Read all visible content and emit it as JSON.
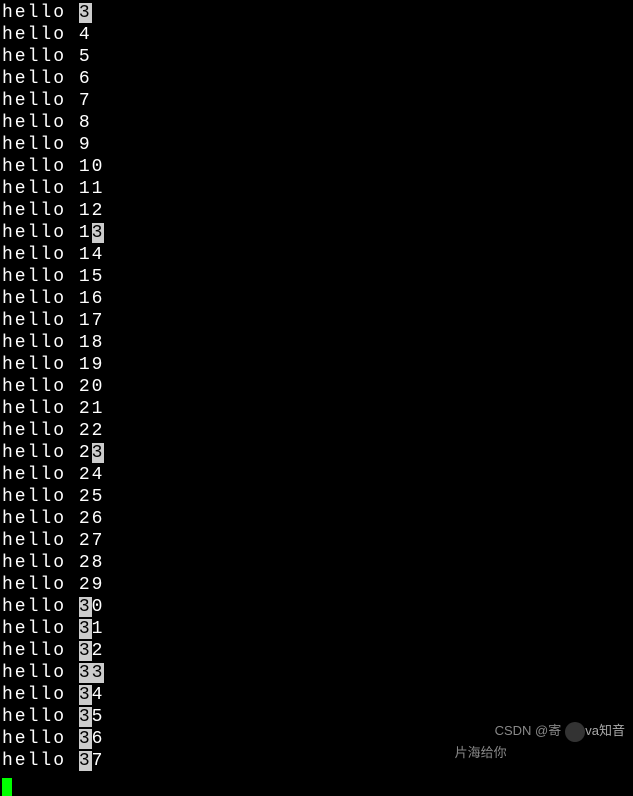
{
  "terminal": {
    "prefix": "hello ",
    "lines": [
      {
        "num": "3",
        "highlight_start": 0,
        "highlight_end": 1
      },
      {
        "num": "4",
        "highlight_start": -1,
        "highlight_end": -1
      },
      {
        "num": "5",
        "highlight_start": -1,
        "highlight_end": -1
      },
      {
        "num": "6",
        "highlight_start": -1,
        "highlight_end": -1
      },
      {
        "num": "7",
        "highlight_start": -1,
        "highlight_end": -1
      },
      {
        "num": "8",
        "highlight_start": -1,
        "highlight_end": -1
      },
      {
        "num": "9",
        "highlight_start": -1,
        "highlight_end": -1
      },
      {
        "num": "10",
        "highlight_start": -1,
        "highlight_end": -1
      },
      {
        "num": "11",
        "highlight_start": -1,
        "highlight_end": -1
      },
      {
        "num": "12",
        "highlight_start": -1,
        "highlight_end": -1
      },
      {
        "num": "13",
        "highlight_start": 1,
        "highlight_end": 2
      },
      {
        "num": "14",
        "highlight_start": -1,
        "highlight_end": -1
      },
      {
        "num": "15",
        "highlight_start": -1,
        "highlight_end": -1
      },
      {
        "num": "16",
        "highlight_start": -1,
        "highlight_end": -1
      },
      {
        "num": "17",
        "highlight_start": -1,
        "highlight_end": -1
      },
      {
        "num": "18",
        "highlight_start": -1,
        "highlight_end": -1
      },
      {
        "num": "19",
        "highlight_start": -1,
        "highlight_end": -1
      },
      {
        "num": "20",
        "highlight_start": -1,
        "highlight_end": -1
      },
      {
        "num": "21",
        "highlight_start": -1,
        "highlight_end": -1
      },
      {
        "num": "22",
        "highlight_start": -1,
        "highlight_end": -1
      },
      {
        "num": "23",
        "highlight_start": 1,
        "highlight_end": 2
      },
      {
        "num": "24",
        "highlight_start": -1,
        "highlight_end": -1
      },
      {
        "num": "25",
        "highlight_start": -1,
        "highlight_end": -1
      },
      {
        "num": "26",
        "highlight_start": -1,
        "highlight_end": -1
      },
      {
        "num": "27",
        "highlight_start": -1,
        "highlight_end": -1
      },
      {
        "num": "28",
        "highlight_start": -1,
        "highlight_end": -1
      },
      {
        "num": "29",
        "highlight_start": -1,
        "highlight_end": -1
      },
      {
        "num": "30",
        "highlight_start": 0,
        "highlight_end": 1
      },
      {
        "num": "31",
        "highlight_start": 0,
        "highlight_end": 1
      },
      {
        "num": "32",
        "highlight_start": 0,
        "highlight_end": 1
      },
      {
        "num": "33",
        "highlight_start": 0,
        "highlight_end": 2
      },
      {
        "num": "34",
        "highlight_start": 0,
        "highlight_end": 1
      },
      {
        "num": "35",
        "highlight_start": 0,
        "highlight_end": 1
      },
      {
        "num": "36",
        "highlight_start": 0,
        "highlight_end": 1
      },
      {
        "num": "37",
        "highlight_start": 0,
        "highlight_end": 1
      }
    ]
  },
  "watermark": {
    "text_before": "CSDN @寄",
    "text_after": "片海给你",
    "overlay": "va知音"
  }
}
